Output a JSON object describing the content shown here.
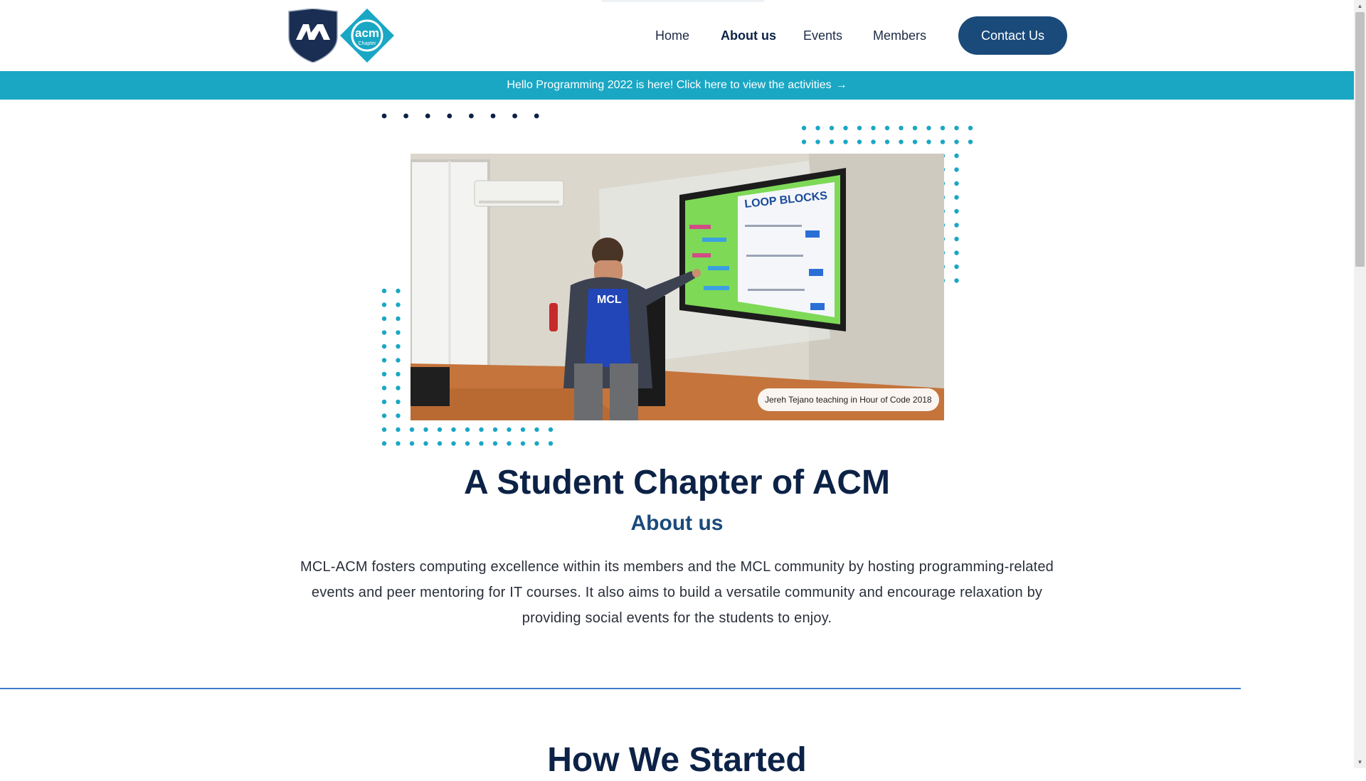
{
  "header": {
    "logo_mcl_icon": "mcl-shield-logo",
    "logo_acm_icon": "acm-diamond-logo",
    "logo_acm_text": "acm",
    "logo_acm_subtext": "Chapter",
    "nav": [
      {
        "label": "Home",
        "active": false
      },
      {
        "label": "About us",
        "active": true
      },
      {
        "label": "Events",
        "active": false
      },
      {
        "label": "Members",
        "active": false
      }
    ],
    "contact_label": "Contact Us"
  },
  "announcement": {
    "text": "Hello Programming 2022 is here! Click here to view the activities",
    "arrow_icon": "arrow-right-icon"
  },
  "hero": {
    "photo_caption": "Jereh Tejano teaching in Hour of Code 2018",
    "screen_title": "LOOP BLOCKS",
    "shirt_text": "MCL",
    "title": "A Student Chapter of ACM",
    "subtitle": "About us",
    "description": "MCL-ACM fosters computing excellence within its members and the MCL community by hosting programming-related events and peer mentoring for IT courses. It also aims to build a versatile community and encourage relaxation by providing social events for the students to enjoy."
  },
  "next_section": {
    "title": "How We Started"
  },
  "colors": {
    "navy": "#0c2246",
    "brand_blue": "#1a4a7a",
    "teal": "#1aa7c4",
    "divider": "#3a7bc8"
  }
}
